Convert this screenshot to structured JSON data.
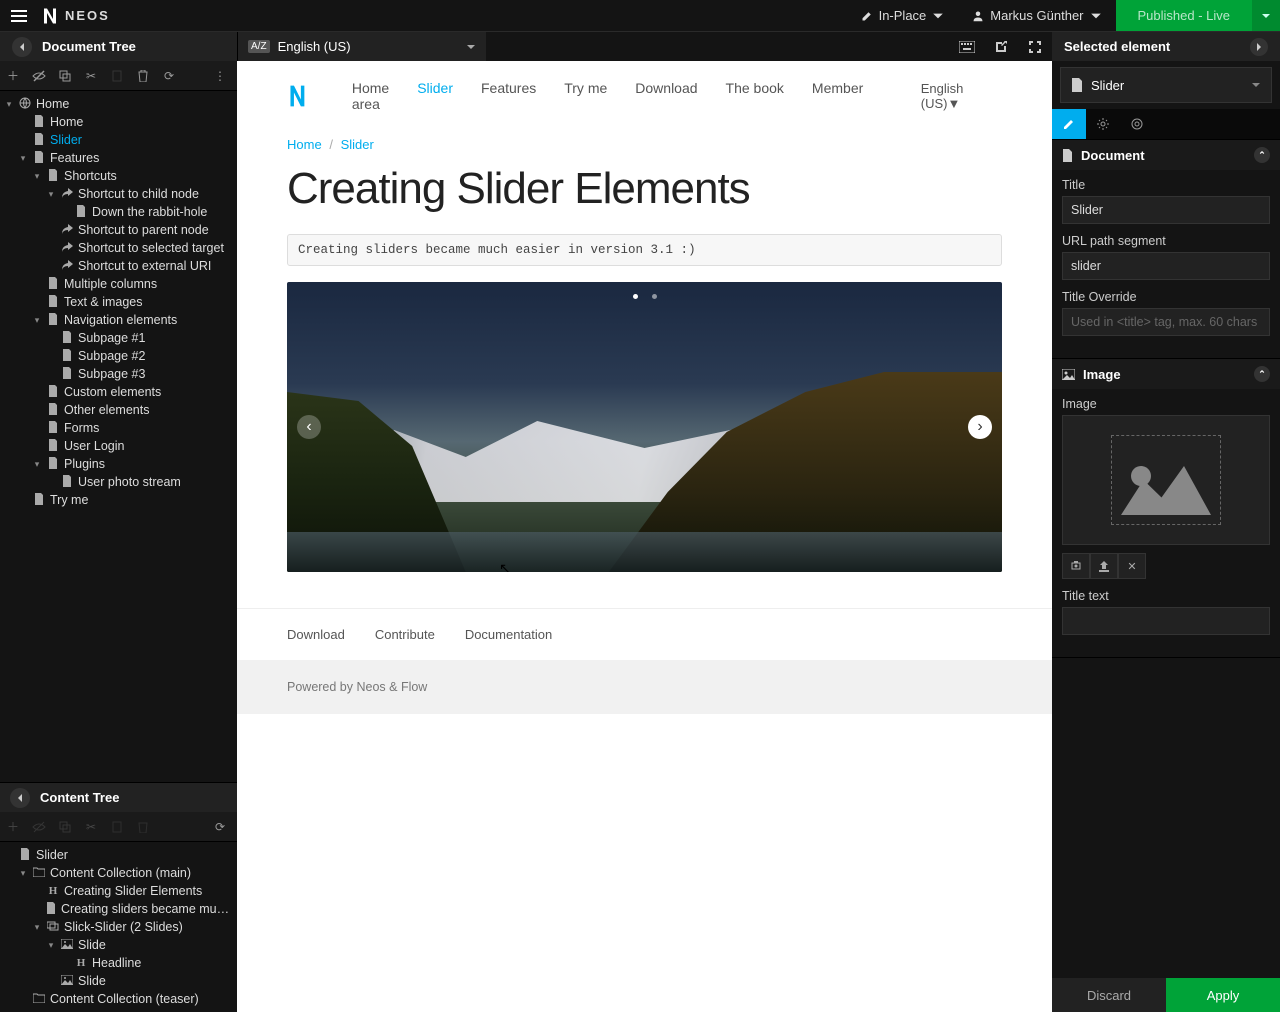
{
  "brand": "NEOS",
  "topbar": {
    "editMode": "In-Place",
    "user": "Markus Günther",
    "publish": "Published - Live"
  },
  "leftPanel": {
    "documentTree": "Document Tree",
    "contentTree": "Content Tree"
  },
  "language": "English (US)",
  "selectedElement": {
    "heading": "Selected element",
    "node": "Slider"
  },
  "inspector": {
    "documentSection": "Document",
    "titleLabel": "Title",
    "titleValue": "Slider",
    "urlLabel": "URL path segment",
    "urlValue": "slider",
    "titleOverrideLabel": "Title Override",
    "titleOverridePlaceholder": "Used in <title> tag, max. 60 chars",
    "imageSection": "Image",
    "imageLabel": "Image",
    "titleTextLabel": "Title text",
    "discard": "Discard",
    "apply": "Apply"
  },
  "docTree": [
    {
      "d": 0,
      "t": "▾",
      "i": "globe",
      "l": "Home"
    },
    {
      "d": 1,
      "t": "",
      "i": "file",
      "l": "Home"
    },
    {
      "d": 1,
      "t": "",
      "i": "file",
      "l": "Slider",
      "active": true
    },
    {
      "d": 1,
      "t": "▾",
      "i": "file",
      "l": "Features"
    },
    {
      "d": 2,
      "t": "▾",
      "i": "file",
      "l": "Shortcuts"
    },
    {
      "d": 3,
      "t": "▾",
      "i": "share",
      "l": "Shortcut to child node"
    },
    {
      "d": 4,
      "t": "",
      "i": "file",
      "l": "Down the rabbit-hole"
    },
    {
      "d": 3,
      "t": "",
      "i": "share",
      "l": "Shortcut to parent node"
    },
    {
      "d": 3,
      "t": "",
      "i": "share",
      "l": "Shortcut to selected target"
    },
    {
      "d": 3,
      "t": "",
      "i": "share",
      "l": "Shortcut to external URI"
    },
    {
      "d": 2,
      "t": "",
      "i": "file",
      "l": "Multiple columns"
    },
    {
      "d": 2,
      "t": "",
      "i": "file",
      "l": "Text & images"
    },
    {
      "d": 2,
      "t": "▾",
      "i": "file",
      "l": "Navigation elements"
    },
    {
      "d": 3,
      "t": "",
      "i": "file",
      "l": "Subpage #1"
    },
    {
      "d": 3,
      "t": "",
      "i": "file",
      "l": "Subpage #2"
    },
    {
      "d": 3,
      "t": "",
      "i": "file",
      "l": "Subpage #3"
    },
    {
      "d": 2,
      "t": "",
      "i": "file",
      "l": "Custom elements"
    },
    {
      "d": 2,
      "t": "",
      "i": "file",
      "l": "Other elements"
    },
    {
      "d": 2,
      "t": "",
      "i": "file",
      "l": "Forms"
    },
    {
      "d": 2,
      "t": "",
      "i": "file",
      "l": "User Login"
    },
    {
      "d": 2,
      "t": "▾",
      "i": "file",
      "l": "Plugins"
    },
    {
      "d": 3,
      "t": "",
      "i": "file",
      "l": "User photo stream"
    },
    {
      "d": 1,
      "t": "",
      "i": "file",
      "l": "Try me"
    }
  ],
  "contentTree": [
    {
      "d": 0,
      "t": "",
      "i": "file",
      "l": "Slider"
    },
    {
      "d": 1,
      "t": "▾",
      "i": "folder",
      "l": "Content Collection (main)"
    },
    {
      "d": 2,
      "t": "",
      "i": "H",
      "l": "Creating Slider Elements"
    },
    {
      "d": 2,
      "t": "",
      "i": "file",
      "l": "Creating sliders became much ea..."
    },
    {
      "d": 2,
      "t": "▾",
      "i": "slides",
      "l": "Slick-Slider (2 Slides)"
    },
    {
      "d": 3,
      "t": "▾",
      "i": "img",
      "l": "Slide"
    },
    {
      "d": 4,
      "t": "",
      "i": "H",
      "l": "Headline"
    },
    {
      "d": 3,
      "t": "",
      "i": "img",
      "l": "Slide"
    },
    {
      "d": 1,
      "t": "",
      "i": "folder",
      "l": "Content Collection (teaser)"
    }
  ],
  "page": {
    "nav": [
      "Home",
      "Slider",
      "Features",
      "Try me",
      "Download",
      "The book",
      "Member area"
    ],
    "navActive": "Slider",
    "langLabel": "English (US)▼",
    "breadcrumbHome": "Home",
    "breadcrumbCurrent": "Slider",
    "title": "Creating Slider Elements",
    "code": "Creating sliders became much easier in version 3.1 :)",
    "footerLinks": [
      "Download",
      "Contribute",
      "Documentation"
    ],
    "powered": "Powered by Neos & Flow"
  }
}
